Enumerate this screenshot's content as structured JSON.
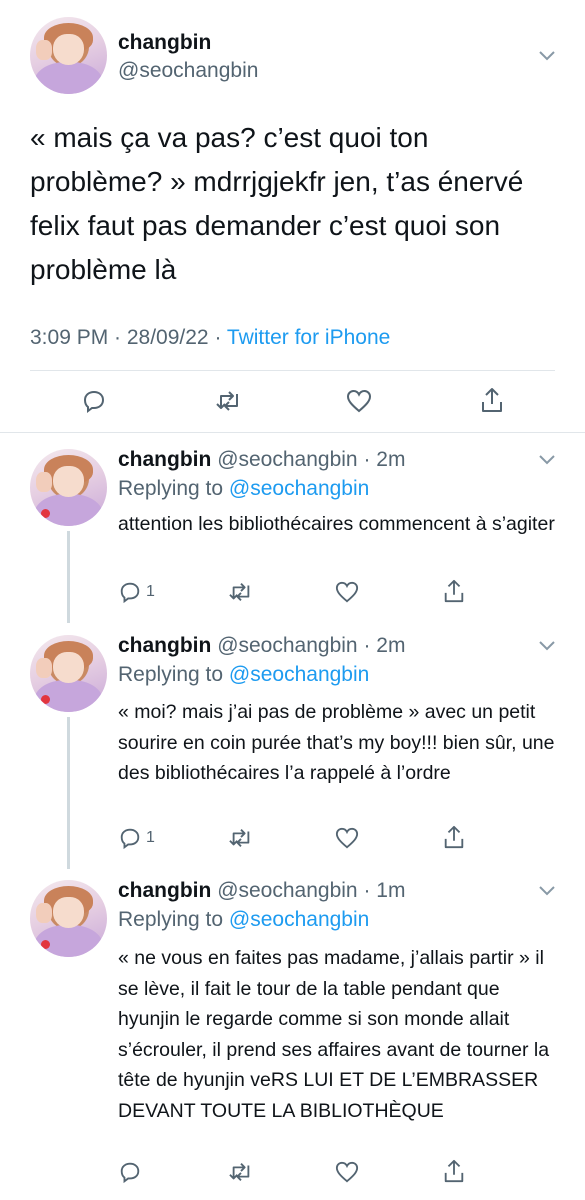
{
  "main_tweet": {
    "name": "changbin",
    "handle": "@seochangbin",
    "text": "« mais ça va pas? c’est quoi ton problème? » mdrrjgjekfr jen, t’as énervé felix faut pas demander c’est quoi son problème là",
    "time": "3:09 PM · 28/09/22 · ",
    "source": "Twitter for iPhone"
  },
  "replies": [
    {
      "name": "changbin",
      "handle": "@seochangbin · 2m",
      "replying_label": "Replying to ",
      "replying_to": "@seochangbin",
      "text": "attention les bibliothécaires commencent à s’agiter",
      "reply_count": "1"
    },
    {
      "name": "changbin",
      "handle": "@seochangbin · 2m",
      "replying_label": "Replying to ",
      "replying_to": "@seochangbin",
      "text": "« moi? mais j’ai pas de problème » avec un petit sourire en coin purée that’s my boy!!! bien sûr, une des bibliothécaires l’a rappelé à l’ordre",
      "reply_count": "1"
    },
    {
      "name": "changbin",
      "handle": "@seochangbin · 1m",
      "replying_label": "Replying to ",
      "replying_to": "@seochangbin",
      "text": "« ne vous en faites pas madame, j’allais partir » il se lève, il fait le tour de la table pendant que hyunjin le regarde comme si son monde allait s’écrouler, il prend ses affaires avant de tourner la tête de hyunjin veRS LUI ET DE L’EMBRASSER DEVANT TOUTE LA BIBLIOTHÈQUE",
      "reply_count": ""
    }
  ],
  "icons": [
    "chevron-down-icon",
    "reply-icon",
    "retweet-icon",
    "like-icon",
    "share-icon"
  ],
  "colors": {
    "link": "#1d9bf0",
    "secondary": "#536471",
    "text": "#0f1419",
    "divider": "#e1e6ea"
  }
}
